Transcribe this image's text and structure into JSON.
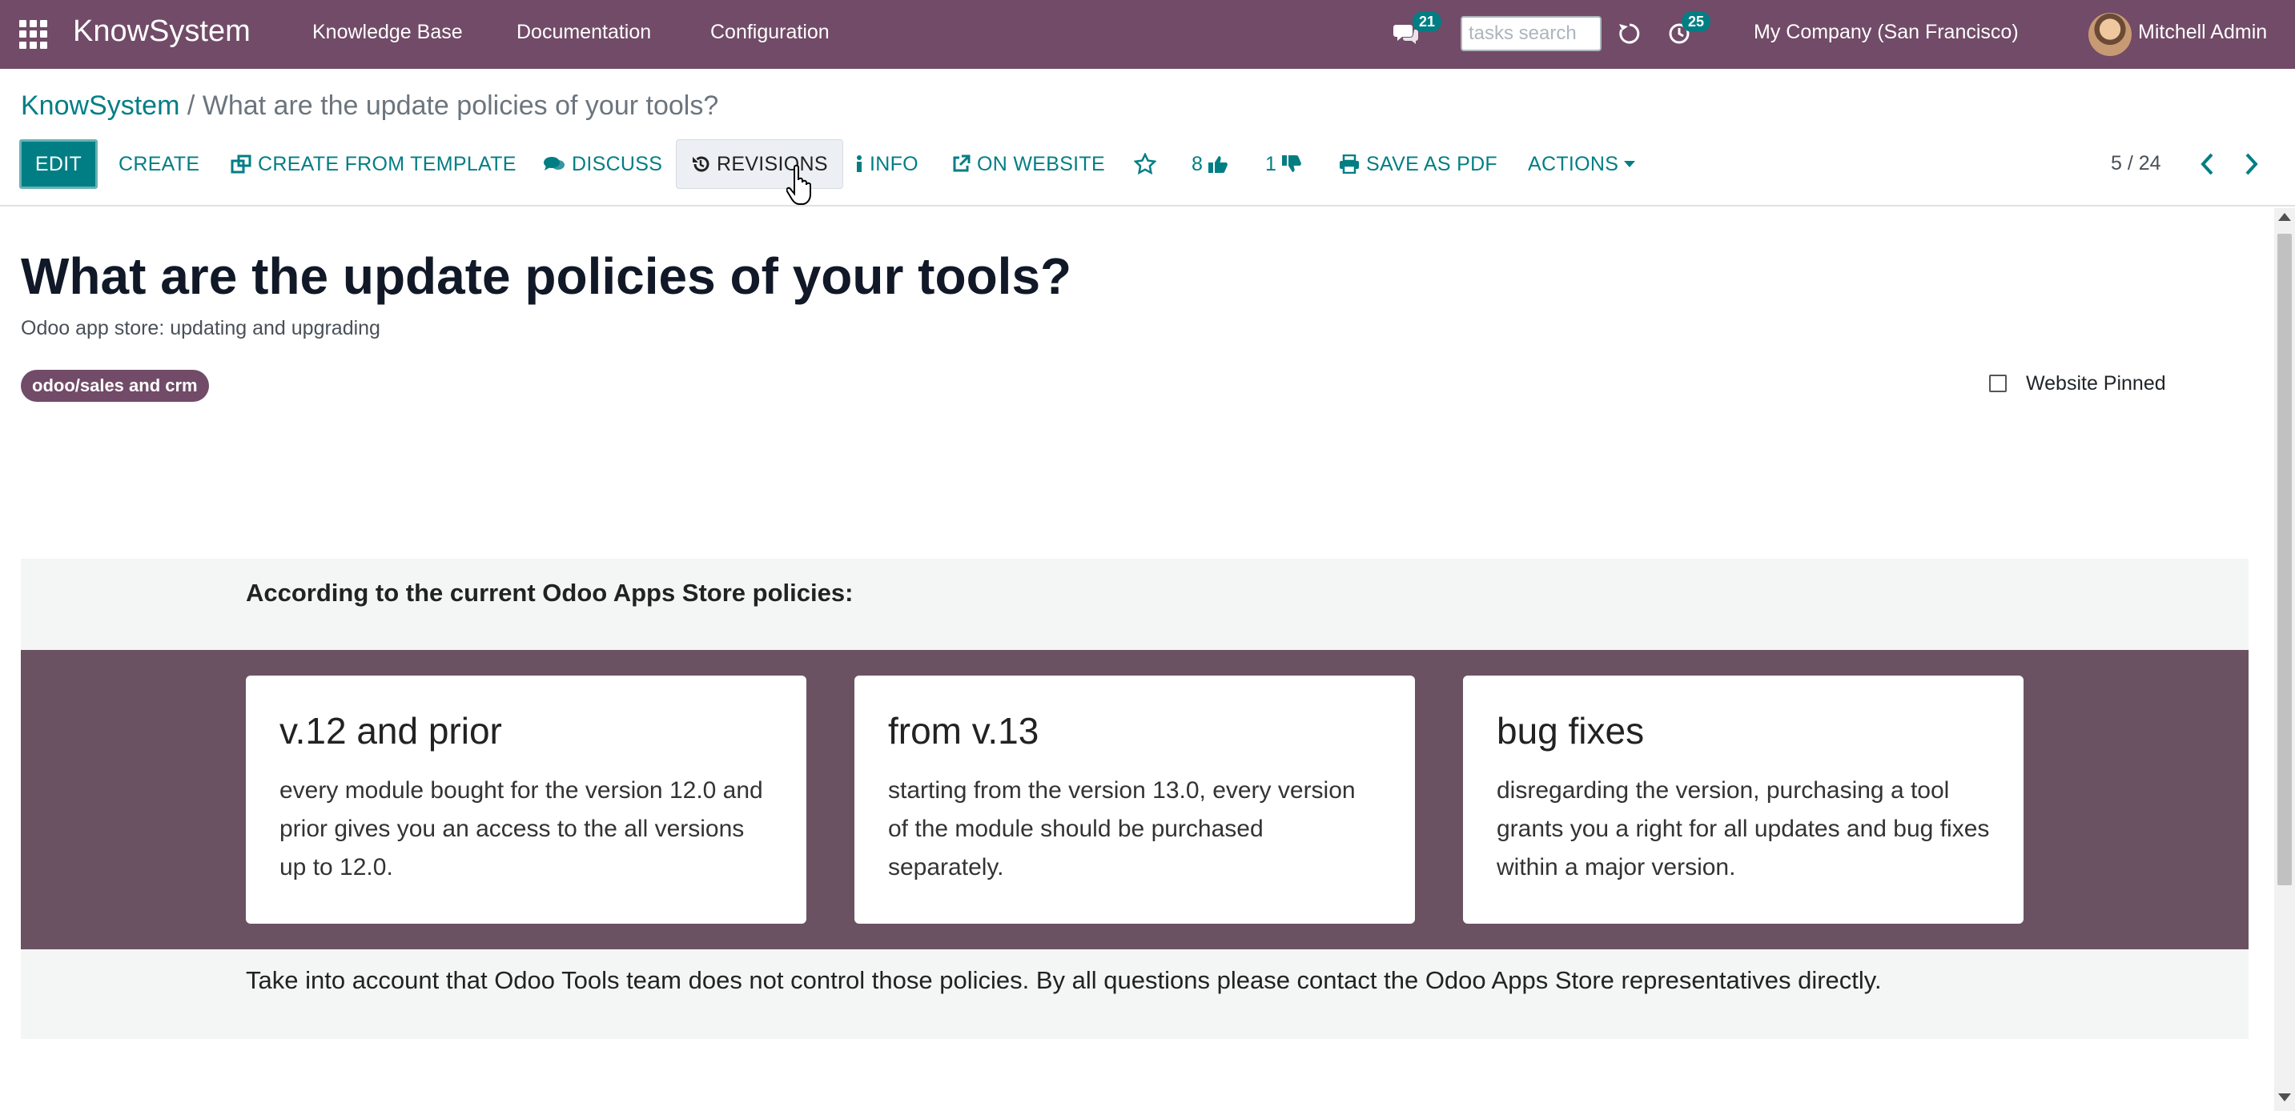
{
  "navbar": {
    "brand": "KnowSystem",
    "menu": [
      "Knowledge Base",
      "Documentation",
      "Configuration"
    ],
    "messages_count": "21",
    "tasks_search_placeholder": "tasks search",
    "activities_count": "25",
    "company": "My Company (San Francisco)",
    "user": "Mitchell Admin",
    "icons": [
      "apps-grid-icon",
      "chat-icon",
      "refresh-icon",
      "activity-clock-icon"
    ]
  },
  "breadcrumb": {
    "parent": "KnowSystem",
    "separator": " / ",
    "current": "What are the update policies of your tools?"
  },
  "toolbar": {
    "edit": "EDIT",
    "create": "CREATE",
    "create_from_template": "CREATE FROM TEMPLATE",
    "discuss": "DISCUSS",
    "revisions": "REVISIONS",
    "info": "INFO",
    "on_website": "ON WEBSITE",
    "likes": "8",
    "dislikes": "1",
    "save_as_pdf": "SAVE AS PDF",
    "actions": "ACTIONS"
  },
  "pager": {
    "value": "5 / 24"
  },
  "article": {
    "title": "What are the update policies of your tools?",
    "subtitle": "Odoo app store: updating and upgrading",
    "tag": "odoo/sales and crm",
    "website_pinned_label": "Website Pinned",
    "website_pinned": false,
    "intro": "According to the current Odoo Apps Store policies:",
    "cards": [
      {
        "title": "v.12 and prior",
        "text": "every module bought for the version 12.0 and prior gives you an access to the all versions up to 12.0."
      },
      {
        "title": "from v.13",
        "text": "starting from the version 13.0, every version of the module should be purchased separately."
      },
      {
        "title": "bug fixes",
        "text": "disregarding the version, purchasing a tool grants you a right for all updates and bug fixes within a major version."
      }
    ],
    "footer_note": "Take into account that Odoo Tools team does not control those policies. By all questions please contact the Odoo Apps Store representatives directly."
  },
  "colors": {
    "navbar": "#714B67",
    "accent": "#017e84",
    "band": "#6a5263",
    "light_band": "#f4f5f5"
  }
}
